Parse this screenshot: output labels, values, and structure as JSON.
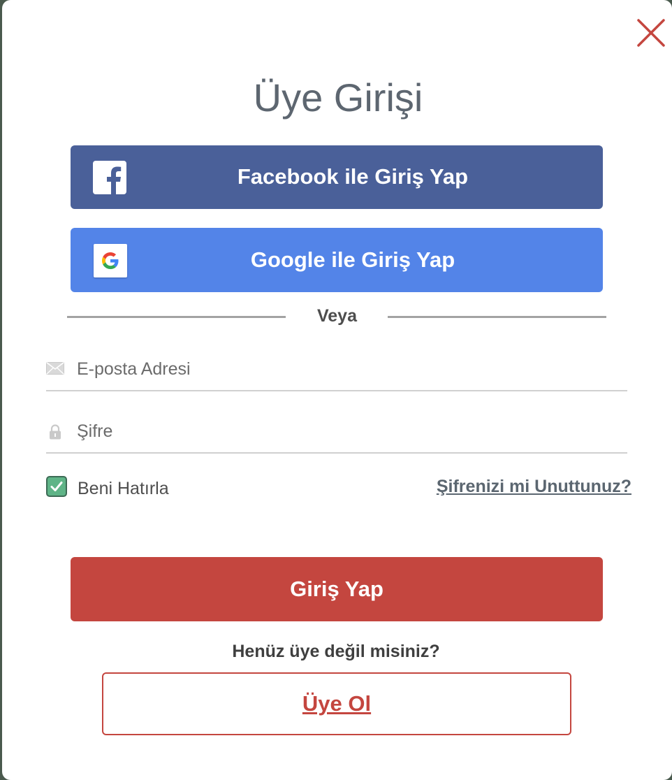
{
  "modal": {
    "title": "Üye Girişi"
  },
  "social": {
    "facebook_label": "Facebook ile Giriş Yap",
    "google_label": "Google ile Giriş Yap"
  },
  "divider": {
    "text": "Veya"
  },
  "form": {
    "email_placeholder": "E-posta Adresi",
    "password_placeholder": "Şifre",
    "remember_label": "Beni Hatırla",
    "remember_checked": true,
    "forgot_link": "Şifrenizi mi Unuttunuz?",
    "login_label": "Giriş Yap"
  },
  "signup": {
    "prompt": "Henüz üye değil misiniz?",
    "button_label": "Üye Ol"
  },
  "icons": {
    "close": "close-icon",
    "facebook": "facebook-icon",
    "google": "google-icon",
    "email": "envelope-icon",
    "password": "lock-icon",
    "checkbox": "checkmark-icon"
  },
  "colors": {
    "facebook": "#4a6099",
    "google": "#5384e8",
    "primary": "#c4463f",
    "checkbox": "#5fb487",
    "title": "#5d6670"
  }
}
